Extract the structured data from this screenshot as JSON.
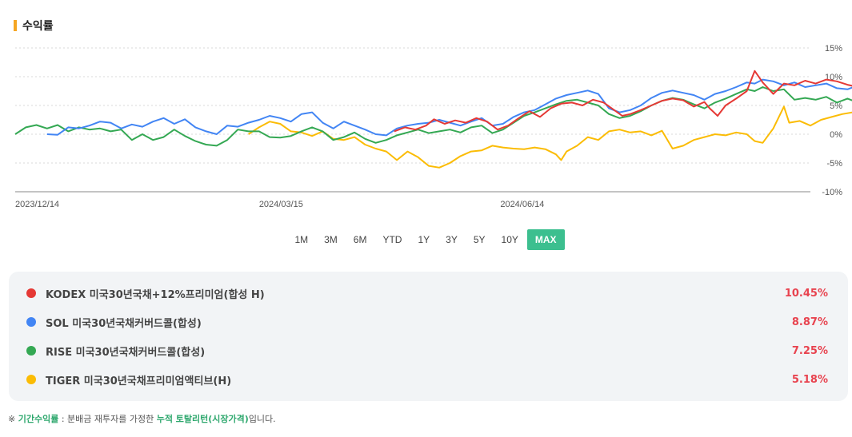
{
  "section_title": "수익률",
  "periods": [
    "1M",
    "3M",
    "6M",
    "YTD",
    "1Y",
    "3Y",
    "5Y",
    "10Y",
    "MAX"
  ],
  "active_period": "MAX",
  "legend": [
    {
      "name": "KODEX 미국30년국채+12%프리미엄(합성 H)",
      "value": "10.45%",
      "color": "#e53935"
    },
    {
      "name": "SOL 미국30년국채커버드콜(합성)",
      "value": "8.87%",
      "color": "#4285f4"
    },
    {
      "name": "RISE 미국30년국채커버드콜(합성)",
      "value": "7.25%",
      "color": "#34a853"
    },
    {
      "name": "TIGER 미국30년국채프리미엄액티브(H)",
      "value": "5.18%",
      "color": "#fbbc05"
    }
  ],
  "note": {
    "prefix": "※ ",
    "term": "기간수익률",
    "middle": " : 분배금 재투자를 가정한 ",
    "term2": "누적 토탈리턴(시장가격)",
    "suffix": "입니다."
  },
  "chart_data": {
    "type": "line",
    "x_tick_labels": [
      "2023/12/14",
      "2024/03/15",
      "2024/06/14"
    ],
    "y_tick_labels": [
      "15%",
      "10%",
      "5%",
      "0%",
      "-5%",
      "-10%"
    ],
    "ylim": [
      -10,
      15
    ],
    "grid": true,
    "x_range_days": 300,
    "x_ticks_days": [
      0,
      92,
      183
    ],
    "series": [
      {
        "name": "KODEX 미국30년국채+12%프리미엄(합성 H)",
        "color": "#e53935",
        "start_day": 143,
        "points": [
          [
            143,
            0.5
          ],
          [
            147,
            1.2
          ],
          [
            151,
            0.8
          ],
          [
            155,
            1.5
          ],
          [
            158,
            2.6
          ],
          [
            162,
            1.8
          ],
          [
            166,
            2.4
          ],
          [
            170,
            2.0
          ],
          [
            174,
            2.8
          ],
          [
            178,
            2.2
          ],
          [
            182,
            0.8
          ],
          [
            186,
            1.5
          ],
          [
            190,
            2.8
          ],
          [
            194,
            4.0
          ],
          [
            198,
            3.0
          ],
          [
            202,
            4.5
          ],
          [
            206,
            5.3
          ],
          [
            210,
            5.5
          ],
          [
            214,
            5.0
          ],
          [
            218,
            6.0
          ],
          [
            222,
            5.5
          ],
          [
            226,
            4.2
          ],
          [
            229,
            3.2
          ],
          [
            232,
            3.5
          ],
          [
            236,
            4.2
          ],
          [
            240,
            5.0
          ],
          [
            244,
            5.8
          ],
          [
            248,
            6.2
          ],
          [
            252,
            5.9
          ],
          [
            256,
            4.8
          ],
          [
            260,
            5.6
          ],
          [
            262,
            4.5
          ],
          [
            265,
            3.2
          ],
          [
            268,
            5.0
          ],
          [
            272,
            6.2
          ],
          [
            276,
            7.5
          ],
          [
            279,
            11.0
          ],
          [
            282,
            9.0
          ],
          [
            286,
            7.0
          ],
          [
            290,
            8.8
          ],
          [
            294,
            8.5
          ],
          [
            298,
            9.3
          ],
          [
            302,
            8.8
          ],
          [
            306,
            9.5
          ],
          [
            310,
            9.2
          ],
          [
            314,
            8.6
          ],
          [
            318,
            8.2
          ],
          [
            322,
            7.2
          ],
          [
            326,
            8.8
          ],
          [
            330,
            10.4
          ]
        ]
      },
      {
        "name": "SOL 미국30년국채커버드콜(합성)",
        "color": "#4285f4",
        "start_day": 12,
        "points": [
          [
            12,
            0
          ],
          [
            16,
            -0.1
          ],
          [
            20,
            1.2
          ],
          [
            24,
            1.0
          ],
          [
            28,
            1.5
          ],
          [
            32,
            2.2
          ],
          [
            36,
            2.0
          ],
          [
            40,
            1.0
          ],
          [
            44,
            1.7
          ],
          [
            48,
            1.3
          ],
          [
            52,
            2.2
          ],
          [
            56,
            2.8
          ],
          [
            60,
            1.8
          ],
          [
            64,
            2.6
          ],
          [
            68,
            1.2
          ],
          [
            72,
            0.5
          ],
          [
            76,
            0.0
          ],
          [
            80,
            1.5
          ],
          [
            84,
            1.3
          ],
          [
            88,
            2.0
          ],
          [
            92,
            2.5
          ],
          [
            96,
            3.2
          ],
          [
            100,
            2.8
          ],
          [
            104,
            2.2
          ],
          [
            108,
            3.5
          ],
          [
            112,
            3.8
          ],
          [
            116,
            2.0
          ],
          [
            120,
            1.0
          ],
          [
            124,
            2.2
          ],
          [
            128,
            1.5
          ],
          [
            132,
            0.8
          ],
          [
            136,
            0.0
          ],
          [
            140,
            -0.2
          ],
          [
            144,
            1.0
          ],
          [
            148,
            1.5
          ],
          [
            152,
            1.8
          ],
          [
            156,
            2.0
          ],
          [
            160,
            2.5
          ],
          [
            164,
            2.0
          ],
          [
            168,
            1.5
          ],
          [
            172,
            2.2
          ],
          [
            176,
            2.8
          ],
          [
            180,
            1.5
          ],
          [
            184,
            1.8
          ],
          [
            188,
            3.0
          ],
          [
            192,
            3.8
          ],
          [
            196,
            4.2
          ],
          [
            200,
            5.2
          ],
          [
            204,
            6.2
          ],
          [
            208,
            6.8
          ],
          [
            212,
            7.2
          ],
          [
            216,
            7.6
          ],
          [
            220,
            7.0
          ],
          [
            224,
            4.5
          ],
          [
            228,
            3.8
          ],
          [
            232,
            4.2
          ],
          [
            236,
            5.0
          ],
          [
            240,
            6.3
          ],
          [
            244,
            7.2
          ],
          [
            248,
            7.6
          ],
          [
            252,
            7.2
          ],
          [
            256,
            6.8
          ],
          [
            260,
            6.0
          ],
          [
            264,
            7.0
          ],
          [
            268,
            7.5
          ],
          [
            272,
            8.2
          ],
          [
            276,
            9.0
          ],
          [
            279,
            8.8
          ],
          [
            282,
            9.5
          ],
          [
            286,
            9.2
          ],
          [
            290,
            8.5
          ],
          [
            294,
            9.0
          ],
          [
            298,
            8.2
          ],
          [
            302,
            8.5
          ],
          [
            306,
            8.8
          ],
          [
            310,
            8.0
          ],
          [
            314,
            7.8
          ],
          [
            318,
            8.5
          ],
          [
            322,
            7.4
          ],
          [
            326,
            8.8
          ],
          [
            330,
            8.9
          ]
        ]
      },
      {
        "name": "RISE 미국30년국채커버드콜(합성)",
        "color": "#34a853",
        "start_day": 0,
        "points": [
          [
            0,
            0
          ],
          [
            4,
            1.2
          ],
          [
            8,
            1.6
          ],
          [
            12,
            1.0
          ],
          [
            16,
            1.6
          ],
          [
            20,
            0.5
          ],
          [
            24,
            1.2
          ],
          [
            28,
            0.8
          ],
          [
            32,
            1.0
          ],
          [
            36,
            0.5
          ],
          [
            40,
            0.8
          ],
          [
            44,
            -1.0
          ],
          [
            48,
            0.0
          ],
          [
            52,
            -1.0
          ],
          [
            56,
            -0.5
          ],
          [
            60,
            0.8
          ],
          [
            64,
            -0.3
          ],
          [
            68,
            -1.2
          ],
          [
            72,
            -1.8
          ],
          [
            76,
            -2.0
          ],
          [
            80,
            -1.0
          ],
          [
            84,
            0.8
          ],
          [
            88,
            0.5
          ],
          [
            92,
            0.5
          ],
          [
            96,
            -0.5
          ],
          [
            100,
            -0.6
          ],
          [
            104,
            -0.3
          ],
          [
            108,
            0.5
          ],
          [
            112,
            1.2
          ],
          [
            116,
            0.5
          ],
          [
            120,
            -1.0
          ],
          [
            124,
            -0.5
          ],
          [
            128,
            0.3
          ],
          [
            132,
            -0.8
          ],
          [
            136,
            -1.5
          ],
          [
            140,
            -1.0
          ],
          [
            144,
            -0.2
          ],
          [
            148,
            0.3
          ],
          [
            152,
            0.8
          ],
          [
            156,
            0.2
          ],
          [
            160,
            0.5
          ],
          [
            164,
            0.8
          ],
          [
            168,
            0.3
          ],
          [
            172,
            1.2
          ],
          [
            176,
            1.5
          ],
          [
            180,
            0.2
          ],
          [
            184,
            0.8
          ],
          [
            188,
            2.0
          ],
          [
            192,
            3.2
          ],
          [
            196,
            3.8
          ],
          [
            200,
            4.5
          ],
          [
            204,
            5.2
          ],
          [
            208,
            5.8
          ],
          [
            212,
            6.0
          ],
          [
            216,
            5.5
          ],
          [
            220,
            5.0
          ],
          [
            224,
            3.5
          ],
          [
            228,
            2.8
          ],
          [
            232,
            3.2
          ],
          [
            236,
            4.0
          ],
          [
            240,
            5.0
          ],
          [
            244,
            5.8
          ],
          [
            248,
            6.3
          ],
          [
            252,
            6.0
          ],
          [
            256,
            5.2
          ],
          [
            260,
            4.5
          ],
          [
            264,
            5.5
          ],
          [
            268,
            6.2
          ],
          [
            272,
            7.0
          ],
          [
            276,
            7.8
          ],
          [
            279,
            7.5
          ],
          [
            282,
            8.2
          ],
          [
            286,
            7.5
          ],
          [
            290,
            7.8
          ],
          [
            294,
            6.0
          ],
          [
            298,
            6.3
          ],
          [
            302,
            6.0
          ],
          [
            306,
            6.5
          ],
          [
            310,
            5.5
          ],
          [
            314,
            6.2
          ],
          [
            318,
            5.5
          ],
          [
            322,
            6.5
          ],
          [
            326,
            7.2
          ],
          [
            330,
            7.25
          ]
        ]
      },
      {
        "name": "TIGER 미국30년국채프리미엄액티브(H)",
        "color": "#fbbc05",
        "start_day": 88,
        "points": [
          [
            88,
            0.0
          ],
          [
            92,
            1.2
          ],
          [
            96,
            2.2
          ],
          [
            100,
            1.8
          ],
          [
            104,
            0.5
          ],
          [
            108,
            0.3
          ],
          [
            112,
            -0.3
          ],
          [
            116,
            0.5
          ],
          [
            120,
            -0.8
          ],
          [
            124,
            -1.0
          ],
          [
            128,
            -0.5
          ],
          [
            132,
            -1.8
          ],
          [
            136,
            -2.5
          ],
          [
            140,
            -3.0
          ],
          [
            144,
            -4.5
          ],
          [
            148,
            -3.0
          ],
          [
            152,
            -4.0
          ],
          [
            156,
            -5.5
          ],
          [
            160,
            -5.8
          ],
          [
            164,
            -5.0
          ],
          [
            168,
            -3.8
          ],
          [
            172,
            -3.0
          ],
          [
            176,
            -2.8
          ],
          [
            180,
            -2.0
          ],
          [
            184,
            -2.3
          ],
          [
            188,
            -2.5
          ],
          [
            192,
            -2.6
          ],
          [
            196,
            -2.3
          ],
          [
            200,
            -2.6
          ],
          [
            204,
            -3.5
          ],
          [
            206,
            -4.5
          ],
          [
            208,
            -3.0
          ],
          [
            212,
            -2.0
          ],
          [
            216,
            -0.5
          ],
          [
            220,
            -1.0
          ],
          [
            224,
            0.5
          ],
          [
            228,
            0.8
          ],
          [
            232,
            0.3
          ],
          [
            236,
            0.5
          ],
          [
            240,
            -0.2
          ],
          [
            244,
            0.6
          ],
          [
            248,
            -2.5
          ],
          [
            252,
            -2.0
          ],
          [
            256,
            -1.0
          ],
          [
            260,
            -0.5
          ],
          [
            264,
            0.0
          ],
          [
            268,
            -0.2
          ],
          [
            272,
            0.3
          ],
          [
            276,
            0.0
          ],
          [
            279,
            -1.2
          ],
          [
            282,
            -1.5
          ],
          [
            286,
            1.0
          ],
          [
            290,
            4.8
          ],
          [
            292,
            2.0
          ],
          [
            296,
            2.3
          ],
          [
            300,
            1.5
          ],
          [
            304,
            2.5
          ],
          [
            308,
            3.0
          ],
          [
            312,
            3.5
          ],
          [
            316,
            3.8
          ],
          [
            320,
            3.3
          ],
          [
            324,
            2.5
          ],
          [
            328,
            4.0
          ],
          [
            330,
            5.2
          ]
        ]
      }
    ]
  }
}
